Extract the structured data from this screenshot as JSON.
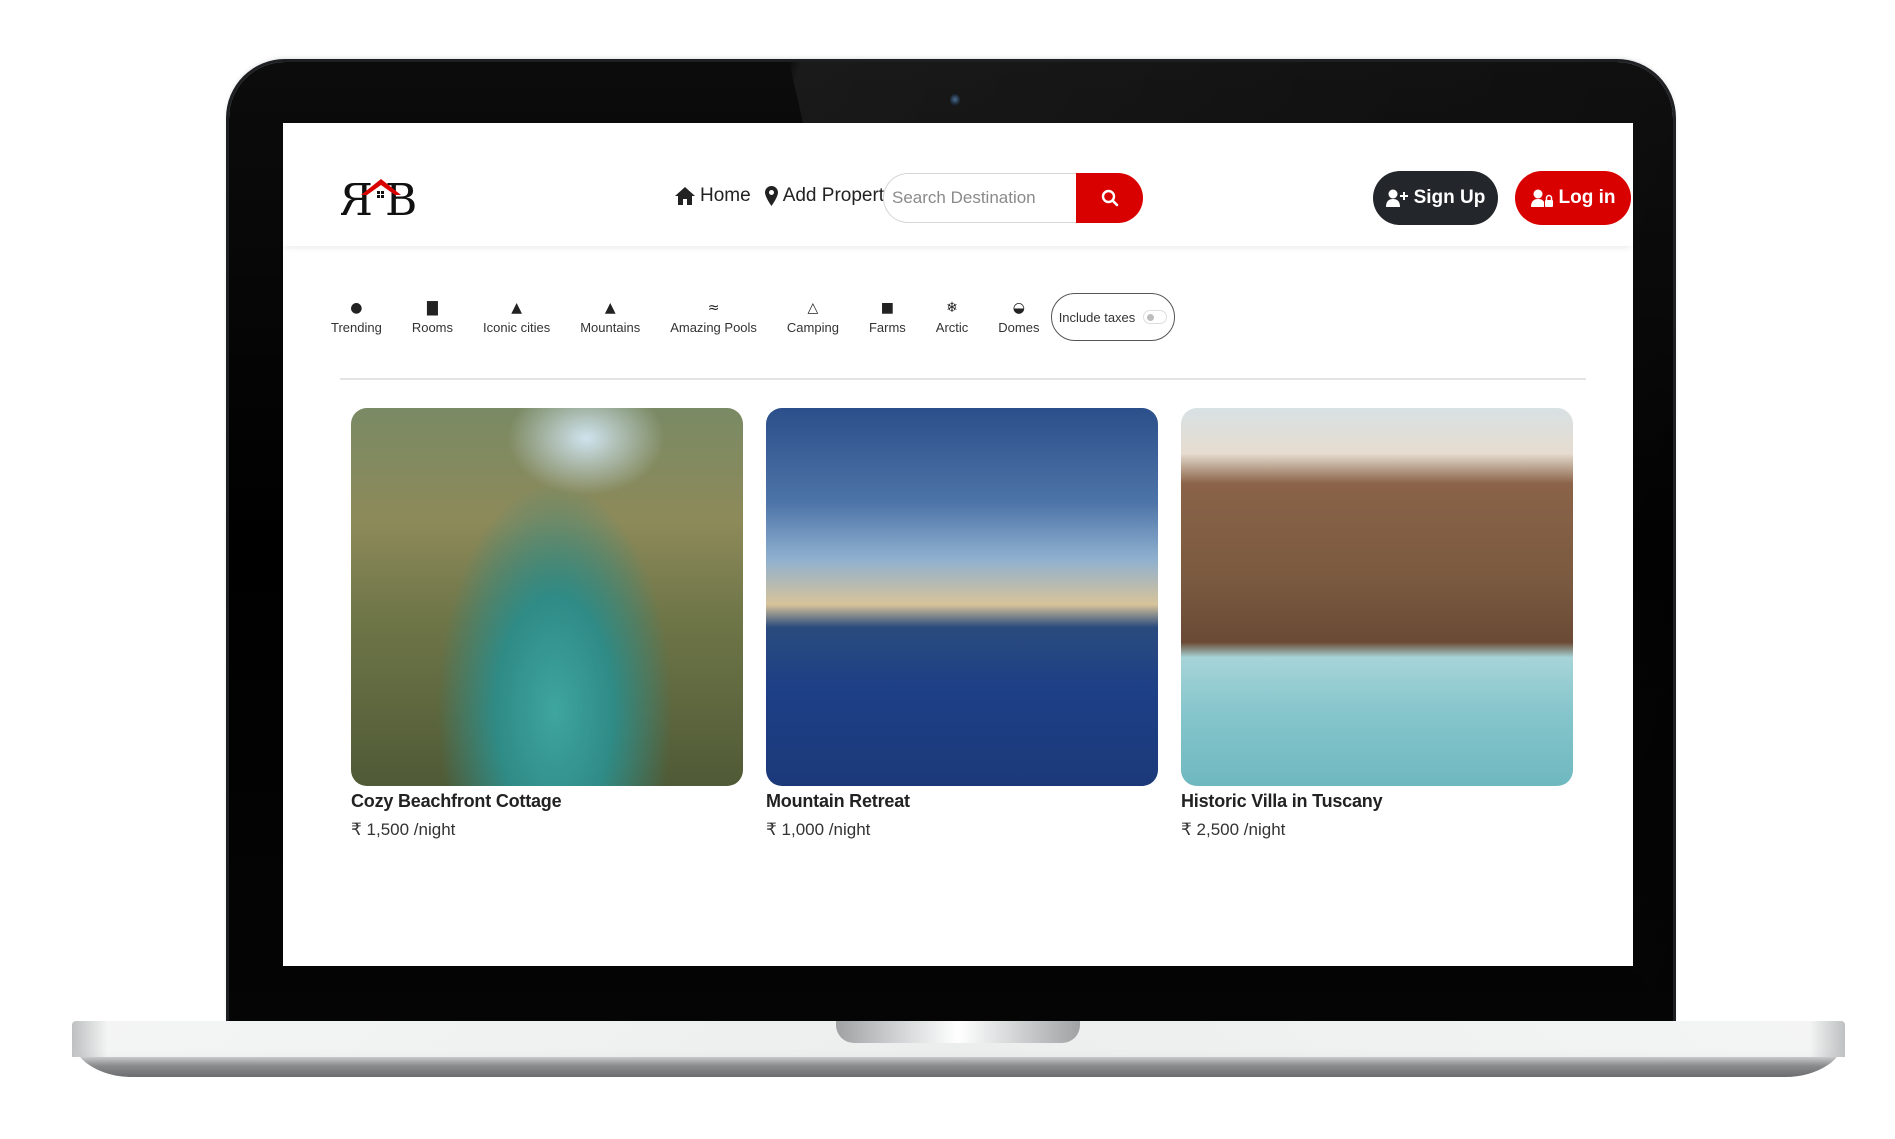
{
  "brand": {
    "logo_text": "RHB",
    "accent_color": "#d90000",
    "dark_color": "#23262a"
  },
  "navbar": {
    "links": [
      {
        "label": "Home",
        "icon": "home-icon"
      },
      {
        "label": "Add Property",
        "icon": "map-pin-icon"
      }
    ],
    "search": {
      "placeholder": "Search Destination",
      "value": "",
      "button_icon": "search-icon"
    },
    "signup_label": "Sign Up",
    "login_label": "Log in"
  },
  "filters": {
    "items": [
      {
        "label": "Trending",
        "icon": "fire-icon",
        "glyph": "🔥"
      },
      {
        "label": "Rooms",
        "icon": "bed-icon",
        "glyph": "🛏"
      },
      {
        "label": "Iconic cities",
        "icon": "city-icon",
        "glyph": "🏙"
      },
      {
        "label": "Mountains",
        "icon": "mountain-icon",
        "glyph": "⛰"
      },
      {
        "label": "Amazing Pools",
        "icon": "swimmer-icon",
        "glyph": "🏊"
      },
      {
        "label": "Camping",
        "icon": "campground-icon",
        "glyph": "⛺"
      },
      {
        "label": "Farms",
        "icon": "tractor-icon",
        "glyph": "🚜"
      },
      {
        "label": "Arctic",
        "icon": "snowflake-icon",
        "glyph": "❄"
      },
      {
        "label": "Domes",
        "icon": "igloo-icon",
        "glyph": "⌂"
      }
    ],
    "tax_toggle": {
      "label": "Include taxes",
      "checked": false
    }
  },
  "listings": [
    {
      "title": "Cozy Beachfront Cottage",
      "price": "₹ 1,500 /night",
      "image": "jungle river with palm trees and canoe"
    },
    {
      "title": "Mountain Retreat",
      "price": "₹ 1,000 /night",
      "image": "resort pool at dusk"
    },
    {
      "title": "Historic Villa in Tuscany",
      "price": "₹ 2,500 /night",
      "image": "wooden villa with pool and loungers"
    }
  ]
}
